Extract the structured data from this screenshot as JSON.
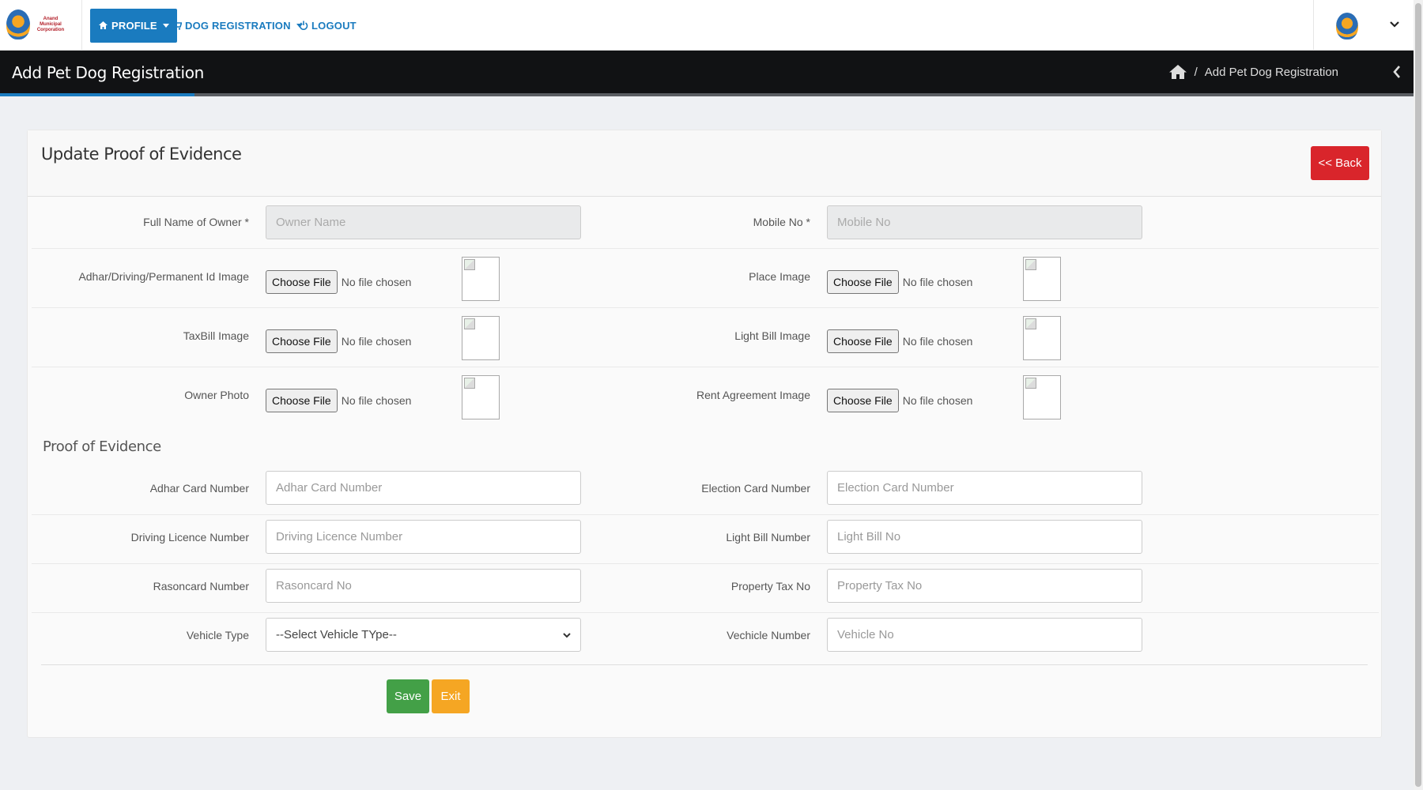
{
  "logo": {
    "text": "Anand Municipal Corporation"
  },
  "nav": {
    "profile_label": "PROFILE",
    "dog_registration_label": "DOG REGISTRATION",
    "logout_label": "LOGOUT"
  },
  "titlebar": {
    "title": "Add Pet Dog Registration",
    "breadcrumb_separator": "/",
    "breadcrumb_current": "Add Pet Dog Registration"
  },
  "card": {
    "title": "Update Proof of Evidence",
    "back_label": "<< Back",
    "section_heading": "Proof of Evidence",
    "save_label": "Save",
    "exit_label": "Exit"
  },
  "owner_row": {
    "left_label": "Full Name of Owner *",
    "left_placeholder": "Owner Name",
    "right_label": "Mobile No *",
    "right_placeholder": "Mobile No"
  },
  "file_rows": [
    {
      "left_label": "Adhar/Driving/Permanent Id Image",
      "right_label": "Place Image"
    },
    {
      "left_label": "TaxBill Image",
      "right_label": "Light Bill Image"
    },
    {
      "left_label": "Owner Photo",
      "right_label": "Rent Agreement Image"
    }
  ],
  "file_input": {
    "button_label": "Choose File",
    "status": "No file chosen"
  },
  "evidence_rows": [
    {
      "left_label": "Adhar Card Number",
      "left_placeholder": "Adhar Card Number",
      "right_label": "Election Card Number",
      "right_placeholder": "Election Card Number"
    },
    {
      "left_label": "Driving Licence Number",
      "left_placeholder": "Driving Licence Number",
      "right_label": "Light Bill Number",
      "right_placeholder": "Light Bill No"
    },
    {
      "left_label": "Rasoncard Number",
      "left_placeholder": "Rasoncard No",
      "right_label": "Property Tax No",
      "right_placeholder": "Property Tax No"
    }
  ],
  "vehicle_row": {
    "left_label": "Vehicle Type",
    "select_value": "--Select Vehicle TYpe--",
    "right_label": "Vechicle Number",
    "right_placeholder": "Vehicle No"
  },
  "colors": {
    "accent_blue": "#1a7bbf",
    "titlebar_bg": "#111214",
    "back_red": "#d9252b",
    "save_green": "#43a047",
    "exit_orange": "#f5a623"
  },
  "icons": {
    "profile": "home-icon",
    "dog_registration": "cart-icon",
    "logout": "power-icon",
    "breadcrumb_home": "home-icon",
    "collapse": "chevron-left-icon",
    "user_menu": "chevron-down-icon",
    "select": "chevron-down-icon"
  }
}
